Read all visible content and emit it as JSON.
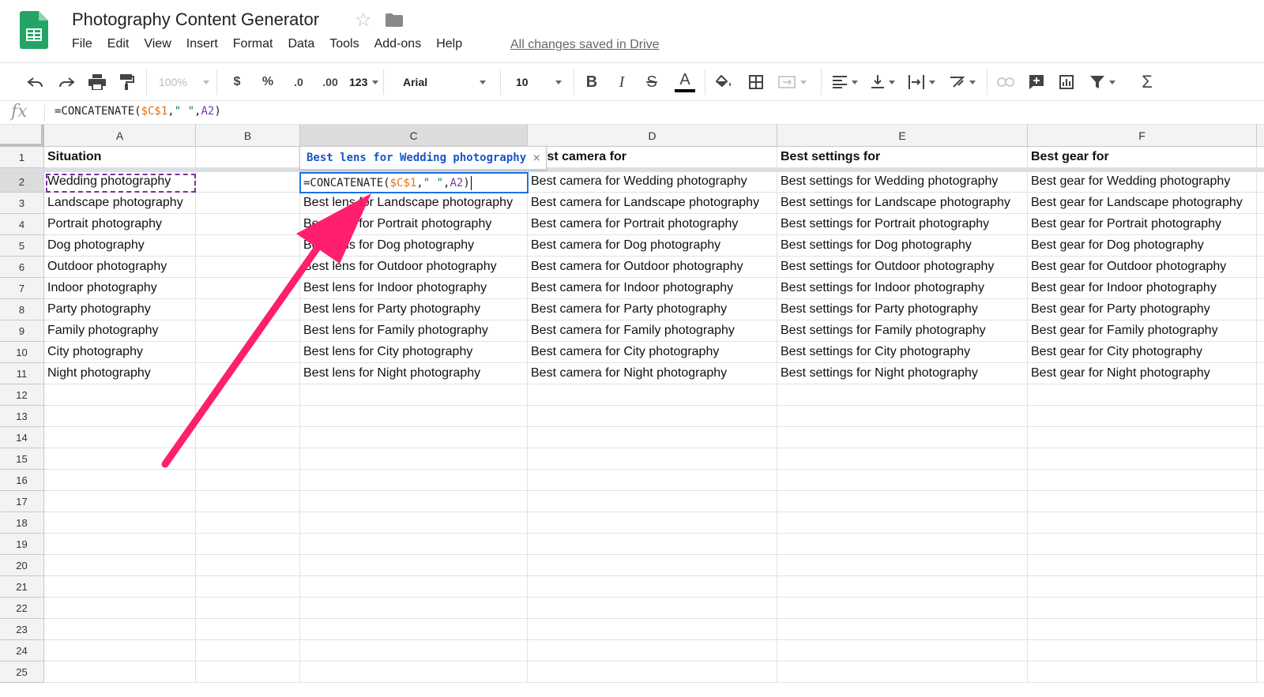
{
  "app": {
    "title": "Photography Content Generator",
    "save_status": "All changes saved in Drive",
    "menu": [
      "File",
      "Edit",
      "View",
      "Insert",
      "Format",
      "Data",
      "Tools",
      "Add-ons",
      "Help"
    ]
  },
  "toolbar": {
    "zoom": "100%",
    "currency": "$",
    "percent": "%",
    "decimal_decrease": ".0",
    "decimal_increase": ".00",
    "more_formats": "123",
    "font": "Arial",
    "font_size": "10",
    "bold": "B",
    "italic": "I",
    "strikethrough": "S",
    "text_color": "A",
    "sum": "Σ"
  },
  "formula_bar": {
    "icon": "fx",
    "formula_prefix": "=CONCATENATE(",
    "formula_ref1": "$C$1",
    "formula_mid": ",",
    "formula_str": "\" \"",
    "formula_mid2": ",",
    "formula_ref2": "A2",
    "formula_suffix": ")"
  },
  "columns": [
    "A",
    "B",
    "C",
    "D",
    "E",
    "F"
  ],
  "rows": [
    "1",
    "2",
    "3",
    "4",
    "5",
    "6",
    "7",
    "8",
    "9",
    "10",
    "11",
    "12",
    "13",
    "14",
    "15",
    "16",
    "17",
    "18",
    "19",
    "20",
    "21",
    "22",
    "23",
    "24",
    "25"
  ],
  "cells": {
    "header": [
      "Situation",
      "",
      "Best lens for",
      "Best camera for",
      "Best settings for",
      "Best gear for"
    ],
    "data": [
      [
        "Wedding photography",
        "",
        "",
        "Best camera for Wedding photography",
        "Best settings for Wedding photography",
        "Best gear for Wedding photography"
      ],
      [
        "Landscape photography",
        "",
        "Best lens for Landscape photography",
        "Best camera for Landscape photography",
        "Best settings for Landscape photography",
        "Best gear for Landscape photography"
      ],
      [
        "Portrait photography",
        "",
        "Best lens for Portrait photography",
        "Best camera for Portrait photography",
        "Best settings for Portrait photography",
        "Best gear for Portrait photography"
      ],
      [
        "Dog photography",
        "",
        "Best lens for Dog photography",
        "Best camera for Dog photography",
        "Best settings for Dog photography",
        "Best gear for Dog photography"
      ],
      [
        "Outdoor photography",
        "",
        "Best lens for Outdoor photography",
        "Best camera for Outdoor photography",
        "Best settings for Outdoor photography",
        "Best gear for Outdoor photography"
      ],
      [
        "Indoor photography",
        "",
        "Best lens for Indoor photography",
        "Best camera for Indoor photography",
        "Best settings for Indoor photography",
        "Best gear for Indoor photography"
      ],
      [
        "Party photography",
        "",
        "Best lens for Party photography",
        "Best camera for Party photography",
        "Best settings for Party photography",
        "Best gear for Party photography"
      ],
      [
        "Family photography",
        "",
        "Best lens for Family photography",
        "Best camera for Family photography",
        "Best settings for Family photography",
        "Best gear for Family photography"
      ],
      [
        "City photography",
        "",
        "Best lens for City photography",
        "Best camera for City photography",
        "Best settings for City photography",
        "Best gear for City photography"
      ],
      [
        "Night photography",
        "",
        "Best lens for Night photography",
        "Best camera for Night photography",
        "Best settings for Night photography",
        "Best gear for Night photography"
      ]
    ]
  },
  "active_cell": {
    "tooltip_value": "Best lens for Wedding photography",
    "tooltip_close": "×"
  },
  "colors": {
    "sheets_green": "#23a566",
    "selection_blue": "#1a73e8",
    "copy_border_purple": "#7b2ea0",
    "arrow_pink": "#ff1f6e",
    "ref_orange": "#e8710a"
  }
}
